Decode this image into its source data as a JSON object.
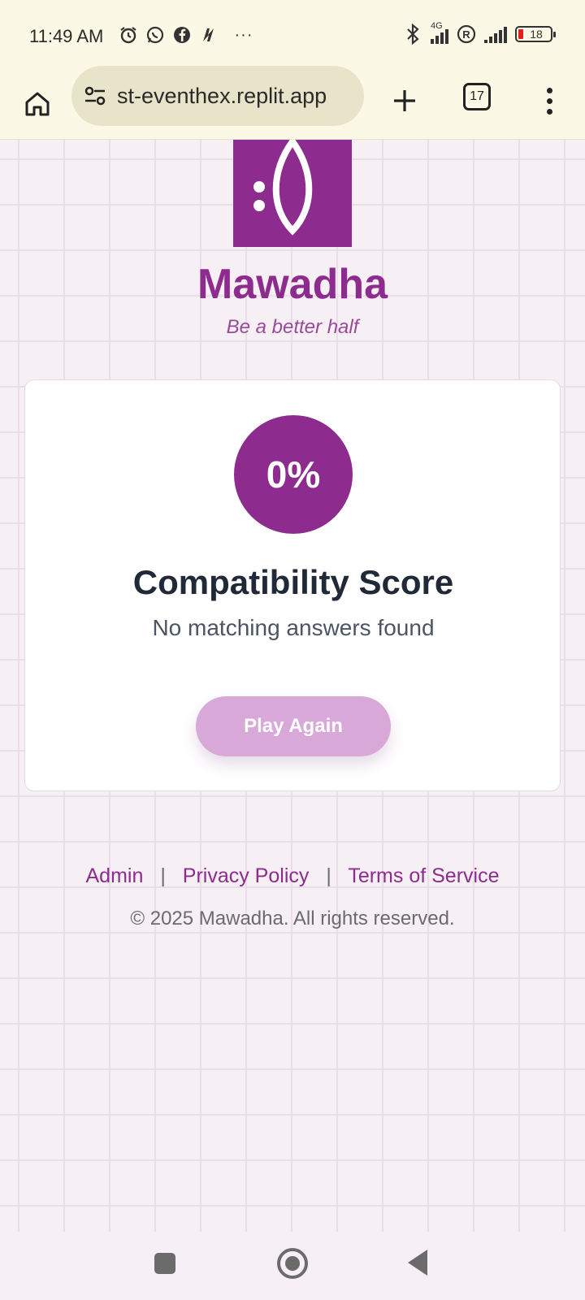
{
  "status_bar": {
    "time": "11:49 AM",
    "ellipsis": "···",
    "network": "4G",
    "battery": "18",
    "icons": [
      "alarm-icon",
      "whatsapp-icon",
      "facebook-icon",
      "n-app-icon",
      "bluetooth-icon",
      "signal-icon",
      "roaming-icon",
      "signal-2-icon",
      "battery-icon"
    ]
  },
  "browser": {
    "url": "st-eventhex.replit.app",
    "tab_count": "17"
  },
  "brand": {
    "name": "Mawadha",
    "tagline": "Be a better half",
    "color": "#8e2b8e"
  },
  "result_card": {
    "score": "0%",
    "title": "Compatibility Score",
    "subtitle": "No matching answers found",
    "play_again_label": "Play Again",
    "button_color": "#d8a8d8"
  },
  "footer": {
    "links": [
      "Admin",
      "Privacy Policy",
      "Terms of Service"
    ],
    "separator": "|",
    "copyright": "© 2025 Mawadha. All rights reserved."
  }
}
